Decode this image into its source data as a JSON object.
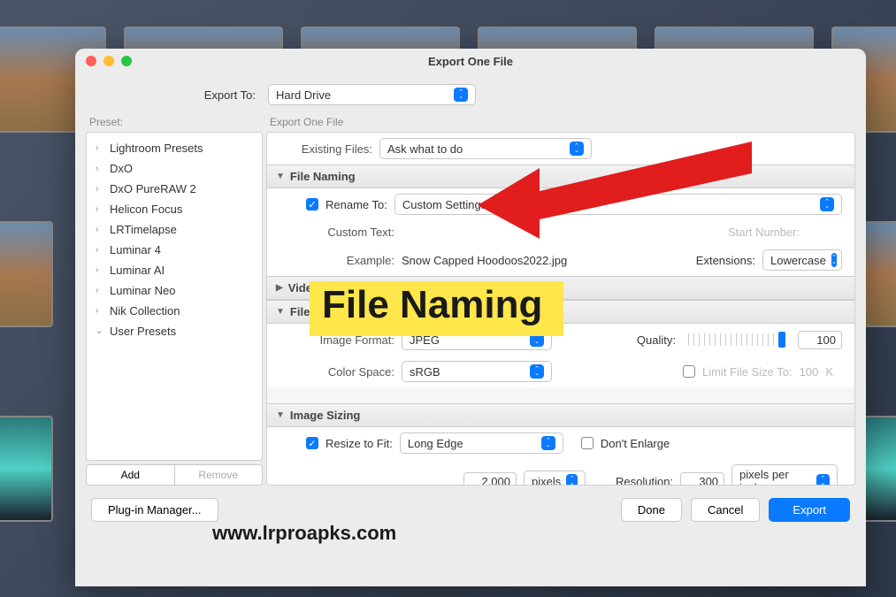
{
  "dialog_title": "Export One File",
  "export_to": {
    "label": "Export To:",
    "value": "Hard Drive"
  },
  "preset_label": "Preset:",
  "presets": [
    "Lightroom Presets",
    "DxO",
    "DxO PureRAW 2",
    "Helicon Focus",
    "LRTimelapse",
    "Luminar 4",
    "Luminar AI",
    "Luminar Neo",
    "Nik Collection",
    "User Presets"
  ],
  "preset_add": "Add",
  "preset_remove": "Remove",
  "main_label": "Export One File",
  "existing_files": {
    "label": "Existing Files:",
    "value": "Ask what to do"
  },
  "file_naming": {
    "header": "File Naming",
    "rename_to_label": "Rename To:",
    "rename_value": "Custom Settings",
    "custom_text_label": "Custom Text:",
    "start_number_label": "Start Number:",
    "example_label": "Example:",
    "example_value": "Snow Capped Hoodoos2022.jpg",
    "extensions_label": "Extensions:",
    "extensions_value": "Lowercase"
  },
  "video": {
    "header": "Video"
  },
  "file_settings": {
    "header": "File Settings",
    "image_format_label": "Image Format:",
    "image_format_value": "JPEG",
    "quality_label": "Quality:",
    "quality_value": "100",
    "color_space_label": "Color Space:",
    "color_space_value": "sRGB",
    "limit_label": "Limit File Size To:",
    "limit_value": "100",
    "limit_unit": "K"
  },
  "image_sizing": {
    "header": "Image Sizing",
    "resize_label": "Resize to Fit:",
    "resize_value": "Long Edge",
    "dont_enlarge": "Don't Enlarge",
    "size_value": "2,000",
    "size_unit": "pixels",
    "resolution_label": "Resolution:",
    "resolution_value": "300",
    "resolution_unit": "pixels per inch"
  },
  "plugin_manager": "Plug-in Manager...",
  "done": "Done",
  "cancel": "Cancel",
  "export": "Export",
  "annotation_text": "File Naming",
  "watermark": "www.lrproapks.com"
}
